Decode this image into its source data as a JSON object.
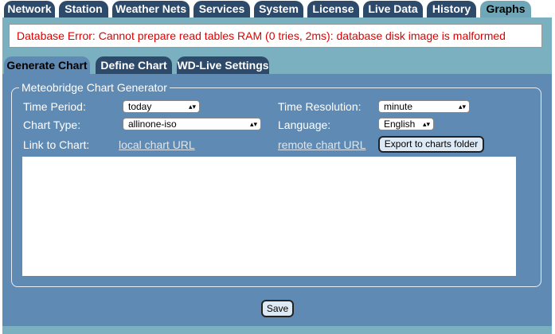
{
  "top_tabs": [
    {
      "label": "Network"
    },
    {
      "label": "Station"
    },
    {
      "label": "Weather Nets"
    },
    {
      "label": "Services"
    },
    {
      "label": "System"
    },
    {
      "label": "License"
    },
    {
      "label": "Live Data"
    },
    {
      "label": "History"
    },
    {
      "label": "Graphs",
      "active": true
    }
  ],
  "error": {
    "text": "Database Error: Cannot prepare read tables RAM (0 tries, 2ms): database disk image is malformed"
  },
  "sub_tabs": [
    {
      "label": "Generate Chart",
      "active": true
    },
    {
      "label": "Define Chart"
    },
    {
      "label": "WD-Live Settings"
    }
  ],
  "generator": {
    "legend": "Meteobridge Chart Generator",
    "time_period_label": "Time Period:",
    "time_period_value": "today",
    "time_resolution_label": "Time Resolution:",
    "time_resolution_value": "minute",
    "chart_type_label": "Chart Type:",
    "chart_type_value": "allinone-iso",
    "language_label": "Language:",
    "language_value": "English",
    "link_label": "Link to Chart:",
    "local_link": "local chart URL",
    "remote_link": "remote chart URL",
    "export_button": "Export to charts folder"
  },
  "save_button": "Save",
  "colors": {
    "tab_bg": "#2d4a6b",
    "active_tab_bg": "#6fa7b8",
    "panel_bg": "#7ab0c0",
    "main_bg": "#5f8ab3",
    "error_text": "#e00000"
  }
}
